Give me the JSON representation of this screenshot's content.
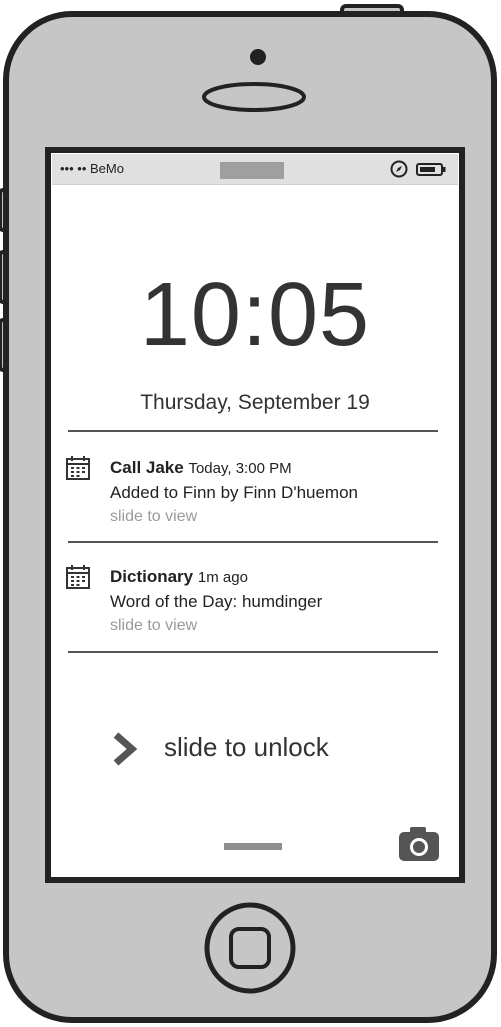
{
  "status_bar": {
    "carrier": "••• •• BeMo",
    "icons": [
      "compass-icon",
      "battery-icon"
    ]
  },
  "lock_screen": {
    "time": "10:05",
    "date": "Thursday, September 19"
  },
  "notifications": [
    {
      "icon": "calendar-icon",
      "title": "Call Jake",
      "time": "Today, 3:00 PM",
      "body": "Added to Finn by Finn D'huemon",
      "action": "slide to view"
    },
    {
      "icon": "calendar-icon",
      "title": "Dictionary",
      "time": "1m ago",
      "body": "Word of the Day: humdinger",
      "action": "slide to view"
    }
  ],
  "unlock": {
    "label": "slide to unlock",
    "icon": "chevron-right-icon"
  },
  "bottom": {
    "camera_icon": "camera-icon"
  },
  "colors": {
    "frame": "#c6c6c6",
    "outline": "#222222",
    "status_bar": "#e0e0e0"
  }
}
